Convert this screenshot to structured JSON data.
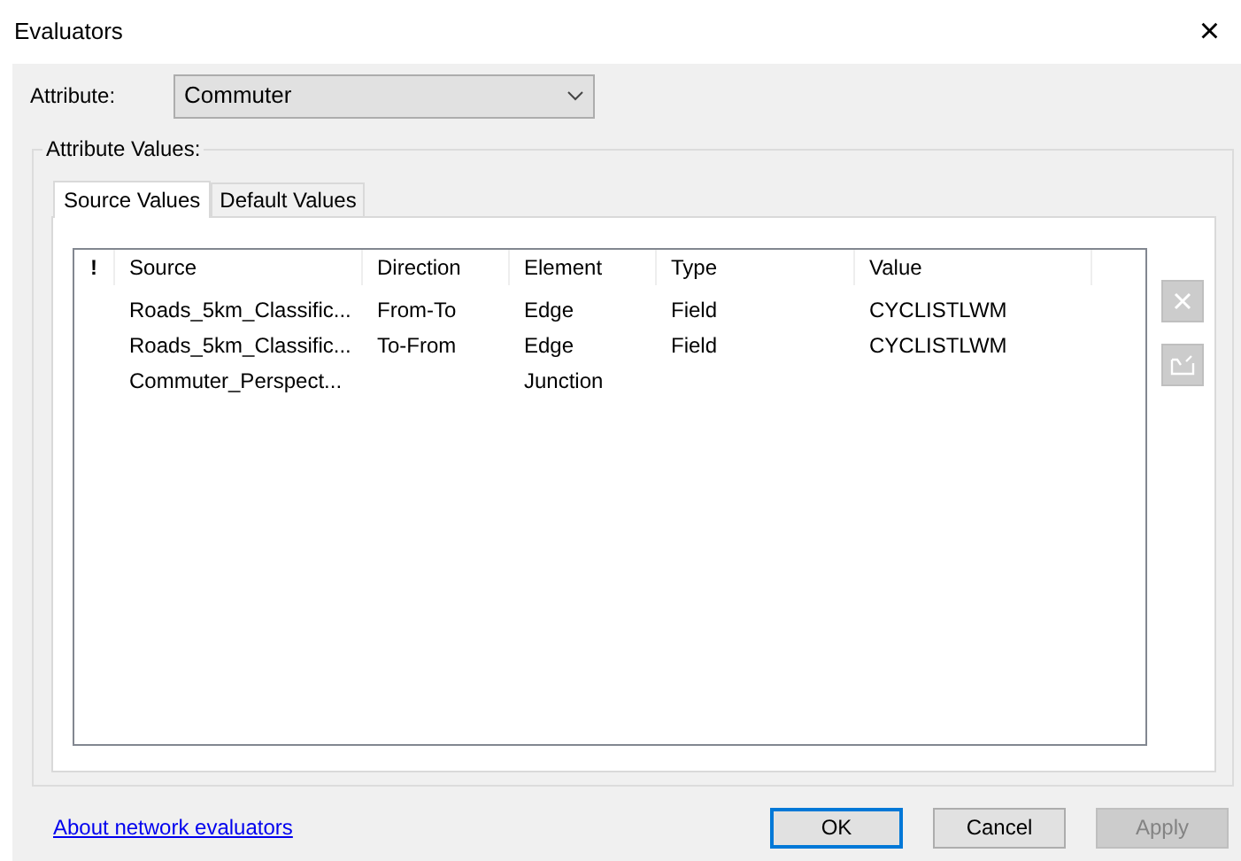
{
  "window": {
    "title": "Evaluators",
    "close": "×"
  },
  "attribute": {
    "label": "Attribute:",
    "value": "Commuter"
  },
  "group": {
    "label": "Attribute Values:"
  },
  "tabs": [
    {
      "label": "Source Values",
      "selected": true
    },
    {
      "label": "Default Values",
      "selected": false
    }
  ],
  "table": {
    "columns": [
      "!",
      "Source",
      "Direction",
      "Element",
      "Type",
      "Value"
    ],
    "rows": [
      [
        "",
        "Roads_5km_Classific...",
        "From-To",
        "Edge",
        "Field",
        "CYCLISTLWM"
      ],
      [
        "",
        "Roads_5km_Classific...",
        "To-From",
        "Edge",
        "Field",
        "CYCLISTLWM"
      ],
      [
        "",
        "Commuter_Perspect...",
        "",
        "Junction",
        "",
        ""
      ]
    ]
  },
  "side_buttons": [
    {
      "kind": "delete",
      "disabled": true
    },
    {
      "kind": "properties",
      "disabled": true
    }
  ],
  "link": "About network evaluators",
  "buttons": [
    {
      "label": "OK",
      "default": true,
      "disabled": false
    },
    {
      "label": "Cancel",
      "default": false,
      "disabled": false
    },
    {
      "label": "Apply",
      "default": false,
      "disabled": true
    }
  ]
}
